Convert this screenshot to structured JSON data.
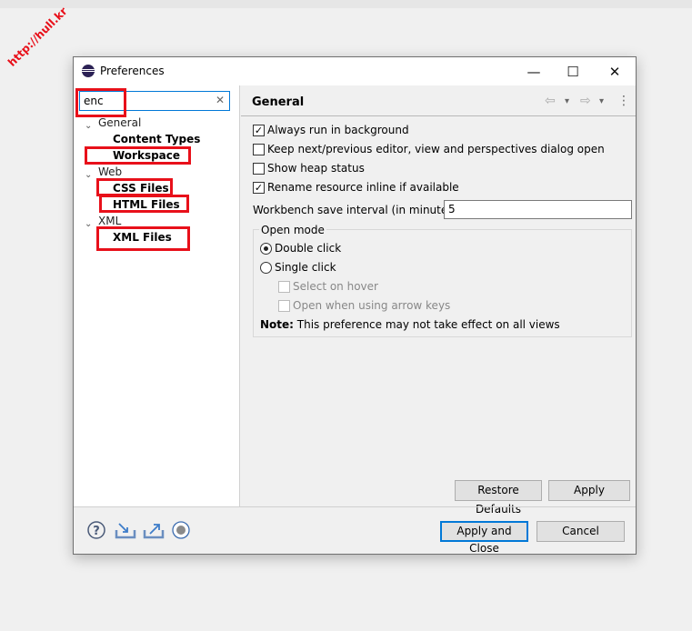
{
  "watermark": "http://hull.kr",
  "window": {
    "title": "Preferences",
    "minimize": "—",
    "maximize": "☐",
    "close": "✕"
  },
  "search": {
    "value": "enc",
    "clear": "✕"
  },
  "tree": [
    {
      "label": "General",
      "children": [
        "Content Types",
        "Workspace"
      ]
    },
    {
      "label": "Web",
      "children": [
        "CSS Files",
        "HTML Files"
      ]
    },
    {
      "label": "XML",
      "children": [
        "XML Files"
      ]
    }
  ],
  "highlight_color": "#e8101a",
  "page": {
    "title": "General",
    "back": "⇦",
    "forward": "⇨",
    "dropdown": "▾",
    "menu": "⋮"
  },
  "options": [
    {
      "label": "Always run in background",
      "checked": true
    },
    {
      "label": "Keep next/previous editor, view and perspectives dialog open",
      "checked": false
    },
    {
      "label": "Show heap status",
      "checked": false
    },
    {
      "label": "Rename resource inline if available",
      "checked": true
    }
  ],
  "interval": {
    "label": "Workbench save interval (in minutes):",
    "value": "5"
  },
  "open_mode": {
    "legend": "Open mode",
    "double": "Double click",
    "single": "Single click",
    "selected": "Double click",
    "hover": "Select on hover",
    "arrow": "Open when using arrow keys",
    "note_bold": "Note:",
    "note": " This preference may not take effect on all views"
  },
  "buttons": {
    "restore": "Restore Defaults",
    "apply": "Apply",
    "apply_close": "Apply and Close",
    "cancel": "Cancel"
  },
  "check": "✓"
}
